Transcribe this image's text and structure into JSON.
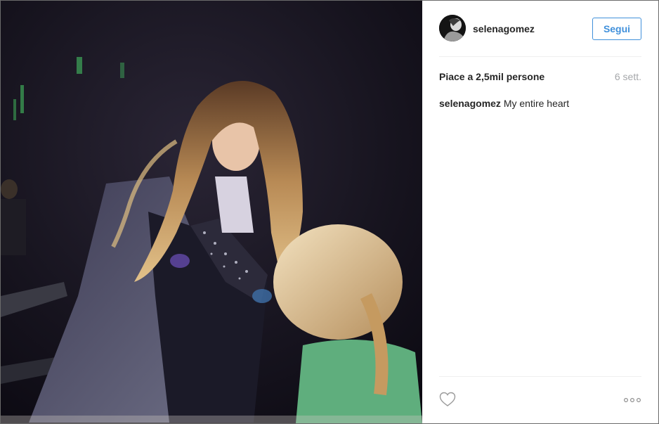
{
  "post": {
    "author": {
      "username": "selenagomez",
      "avatar_icon": "profile-photo"
    },
    "follow_label": "Segui",
    "likes_text": "Piace a 2,5mil persone",
    "timestamp": "6 sett.",
    "caption": {
      "username": "selenagomez",
      "text": "My entire heart"
    },
    "actions": {
      "like_icon": "heart-outline-icon",
      "more_icon": "ellipsis-icon"
    }
  },
  "colors": {
    "accent": "#4090db",
    "text": "#262626",
    "muted": "#a5a7aa",
    "divider": "#efefef"
  }
}
